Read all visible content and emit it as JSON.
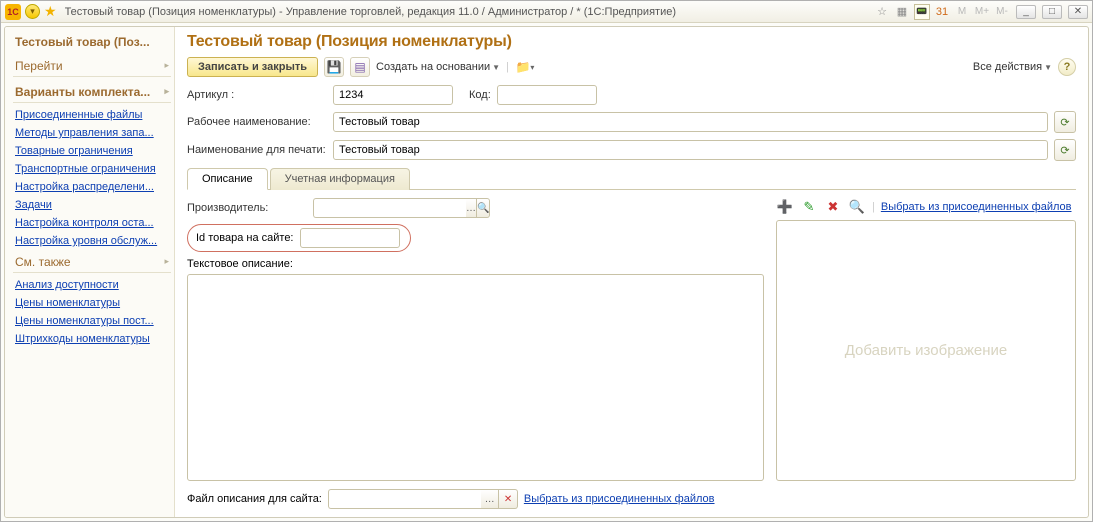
{
  "titlebar": {
    "logo_text": "1C",
    "title": "Тестовый товар (Позиция номенклатуры) - Управление торговлей, редакция 11.0 / Администратор / *  (1С:Предприятие)",
    "m_buttons": [
      "M",
      "M+",
      "M-"
    ]
  },
  "sidebar": {
    "title": "Тестовый товар (Поз...",
    "section_goto": "Перейти",
    "section_variants": "Варианты комплекта...",
    "links1": [
      "Присоединенные файлы",
      "Методы управления запа...",
      "Товарные ограничения",
      "Транспортные ограничения",
      "Настройка распределени...",
      "Задачи",
      "Настройка контроля оста...",
      "Настройка уровня обслуж..."
    ],
    "section_seealso": "См. также",
    "links2": [
      "Анализ доступности",
      "Цены номенклатуры",
      "Цены номенклатуры пост...",
      "Штрихкоды номенклатуры"
    ]
  },
  "main": {
    "page_title": "Тестовый товар (Позиция номенклатуры)",
    "toolbar": {
      "save_close": "Записать и закрыть",
      "create_based": "Создать на основании",
      "all_actions": "Все действия"
    },
    "labels": {
      "article": "Артикул :",
      "code": "Код:",
      "work_name": "Рабочее наименование:",
      "print_name": "Наименование для печати:",
      "manufacturer": "Производитель:",
      "site_id": "Id товара на сайте:",
      "text_desc": "Текстовое описание:",
      "desc_file": "Файл описания для сайта:",
      "pick_attached": "Выбрать из присоединенных файлов",
      "pick_attached2": "Выбрать из присоединенных файлов",
      "add_image": "Добавить изображение"
    },
    "values": {
      "article": "1234",
      "code": "",
      "work_name": "Тестовый товар",
      "print_name": "Тестовый товар",
      "manufacturer": "",
      "site_id": "",
      "text_desc": "",
      "desc_file": ""
    },
    "tabs": {
      "description": "Описание",
      "accounting": "Учетная информация"
    }
  }
}
